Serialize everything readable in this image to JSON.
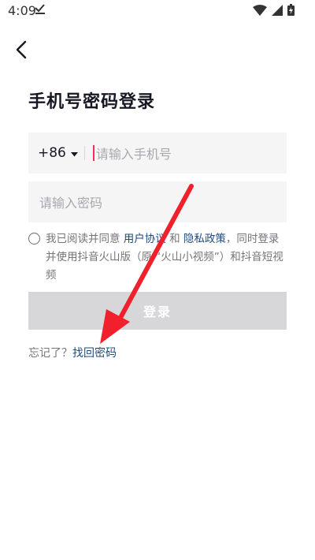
{
  "status_bar": {
    "time": "4:09",
    "icons": [
      "download-done-icon",
      "wifi-icon",
      "signal-icon",
      "battery-charging-icon"
    ]
  },
  "nav": {
    "back_icon": "chevron-left-icon"
  },
  "title": "手机号密码登录",
  "phone": {
    "country_code": "+86",
    "placeholder": "请输入手机号",
    "value": ""
  },
  "password": {
    "placeholder": "请输入密码",
    "value": ""
  },
  "agreement": {
    "checked": false,
    "prefix": "我已阅读并同意 ",
    "user_agreement": "用户协议",
    "and": " 和 ",
    "privacy_policy": "隐私政策",
    "suffix": "，同时登录并使用抖音火山版（原 “火山小视频”）和抖音短视频"
  },
  "login_button": "登录",
  "forgot": {
    "prefix": "忘记了？",
    "link": "找回密码"
  },
  "colors": {
    "cursor": "#fe2c55",
    "link": "#1f4a7e",
    "arrow": "#f0202c",
    "button_disabled": "#d7d7da"
  }
}
